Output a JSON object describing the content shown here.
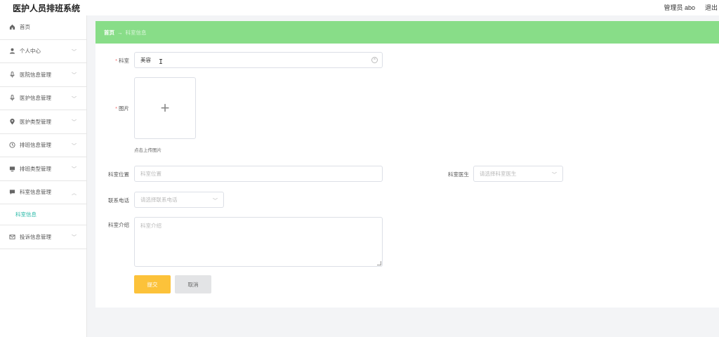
{
  "app": {
    "title": "医护人员排班系统",
    "user": "管理员 abo",
    "logout": "退出"
  },
  "sidebar": {
    "items": [
      {
        "label": "首页",
        "icon": "home-icon"
      },
      {
        "label": "个人中心",
        "icon": "user-icon"
      },
      {
        "label": "医院信息管理",
        "icon": "mic-icon"
      },
      {
        "label": "医护信息管理",
        "icon": "mic-icon"
      },
      {
        "label": "医护类型管理",
        "icon": "location-icon"
      },
      {
        "label": "排班信息管理",
        "icon": "clock-icon"
      },
      {
        "label": "排班类型管理",
        "icon": "monitor-icon"
      },
      {
        "label": "科室信息管理",
        "icon": "chat-icon"
      },
      {
        "label": "投诉信息管理",
        "icon": "mail-icon"
      }
    ],
    "sub_item": "科室信息"
  },
  "breadcrumb": {
    "home": "首页",
    "separator": "→",
    "current": "科室信息"
  },
  "form": {
    "department_label": "科室",
    "department_value": "美容",
    "image_label": "图片",
    "upload_hint": "点击上传图片",
    "location_label": "科室位置",
    "location_placeholder": "科室位置",
    "doctor_label": "科室医生",
    "doctor_placeholder": "请选择科室医生",
    "phone_label": "联系电话",
    "phone_placeholder": "请选择联系电话",
    "intro_label": "科室介绍",
    "intro_placeholder": "科室介绍",
    "submit": "提交",
    "cancel": "取消",
    "required_mark": "*"
  }
}
